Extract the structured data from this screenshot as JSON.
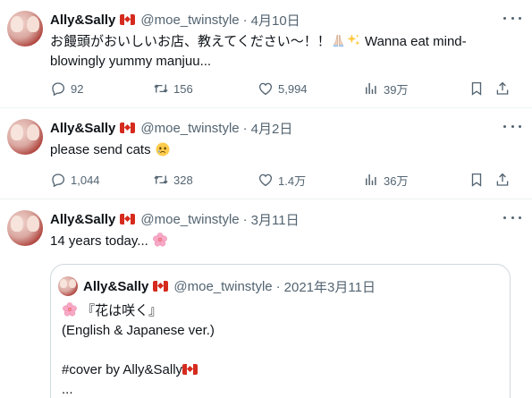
{
  "colors": {
    "text": "#0f1419",
    "secondary": "#536471",
    "border": "#cfd9de",
    "flag_red": "#d52b1e"
  },
  "tweets": [
    {
      "name": "Ally&Sally",
      "handle": "@moe_twinstyle",
      "separator": "·",
      "date": "4月10日",
      "text_before": "お饅頭がおいしいお店、教えてください〜！！",
      "text_after": " Wanna eat mind-blowingly yummy manjuu...",
      "emojis": [
        "folded-hands-icon",
        "sparkles-icon"
      ],
      "stats": {
        "reply": "92",
        "retweet": "156",
        "like": "5,994",
        "views": "39万"
      }
    },
    {
      "name": "Ally&Sally",
      "handle": "@moe_twinstyle",
      "separator": "·",
      "date": "4月2日",
      "text_before": "please send cats ",
      "emojis": [
        "face-holding-back-tears-icon"
      ],
      "stats": {
        "reply": "1,044",
        "retweet": "328",
        "like": "1.4万",
        "views": "36万"
      }
    },
    {
      "name": "Ally&Sally",
      "handle": "@moe_twinstyle",
      "separator": "·",
      "date": "3月11日",
      "text_before": "14 years today... ",
      "emojis": [
        "cherry-blossom-icon"
      ],
      "quote": {
        "name": "Ally&Sally",
        "handle": "@moe_twinstyle",
        "separator": "·",
        "date": "2021年3月11日",
        "line1": "『花は咲く』",
        "line2": "(English & Japanese ver.)",
        "line3": "",
        "line4": "#cover by Ally&Sally",
        "line5": "..."
      }
    }
  ]
}
